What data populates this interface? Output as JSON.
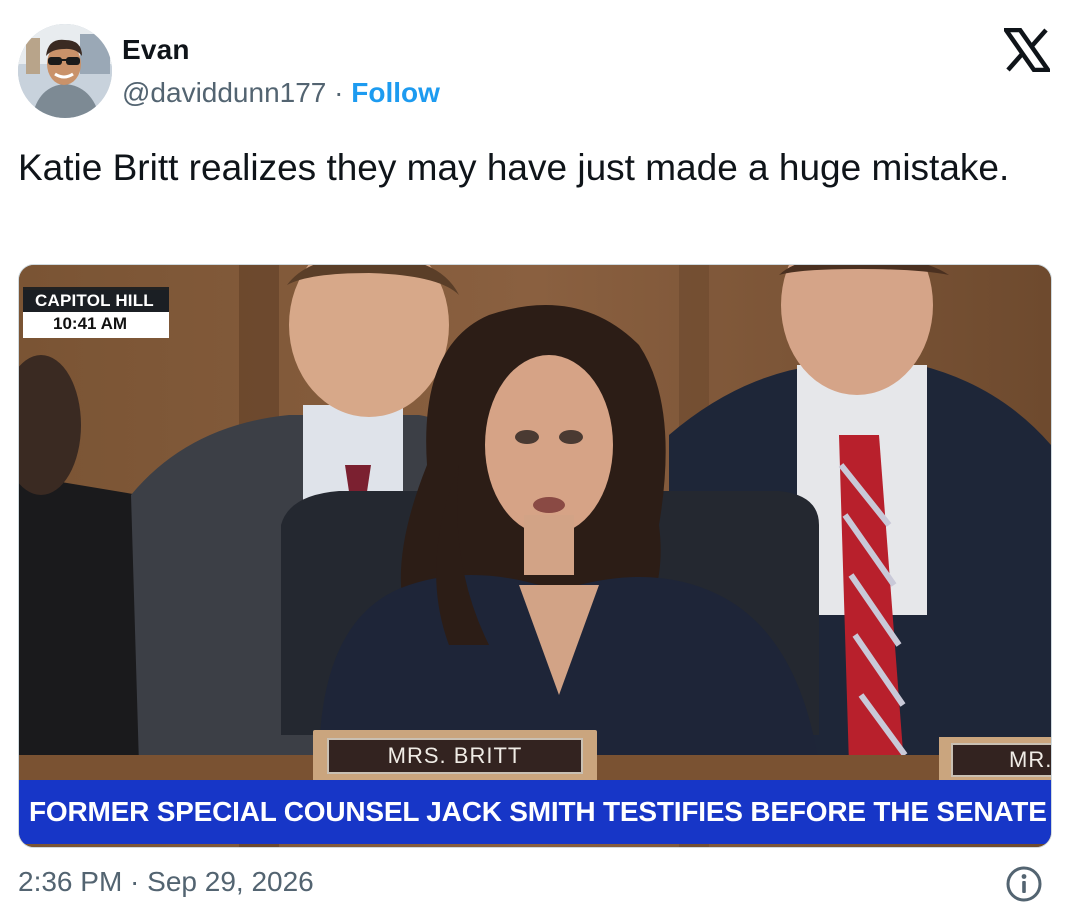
{
  "tweet": {
    "author_name": "Evan",
    "handle": "@daviddunn177",
    "separator": "·",
    "follow_label": "Follow",
    "text": "Katie Britt realizes they may have just made a huge mistake.",
    "timestamp": "2:36 PM · Sep 29, 2026"
  },
  "media": {
    "bug_location": "CAPITOL HILL",
    "bug_time": "10:41 AM",
    "nameplate": "MRS. BRITT",
    "nameplate_partial": "MR. S",
    "ticker": "FORMER SPECIAL COUNSEL JACK SMITH TESTIFIES BEFORE THE SENATE"
  },
  "icons": {
    "platform": "x-logo-icon",
    "info": "info-icon"
  },
  "colors": {
    "accent": "#1d9bf0",
    "ticker_bg": "#1736c7",
    "muted_text": "#536471",
    "primary_text": "#0f1419"
  }
}
